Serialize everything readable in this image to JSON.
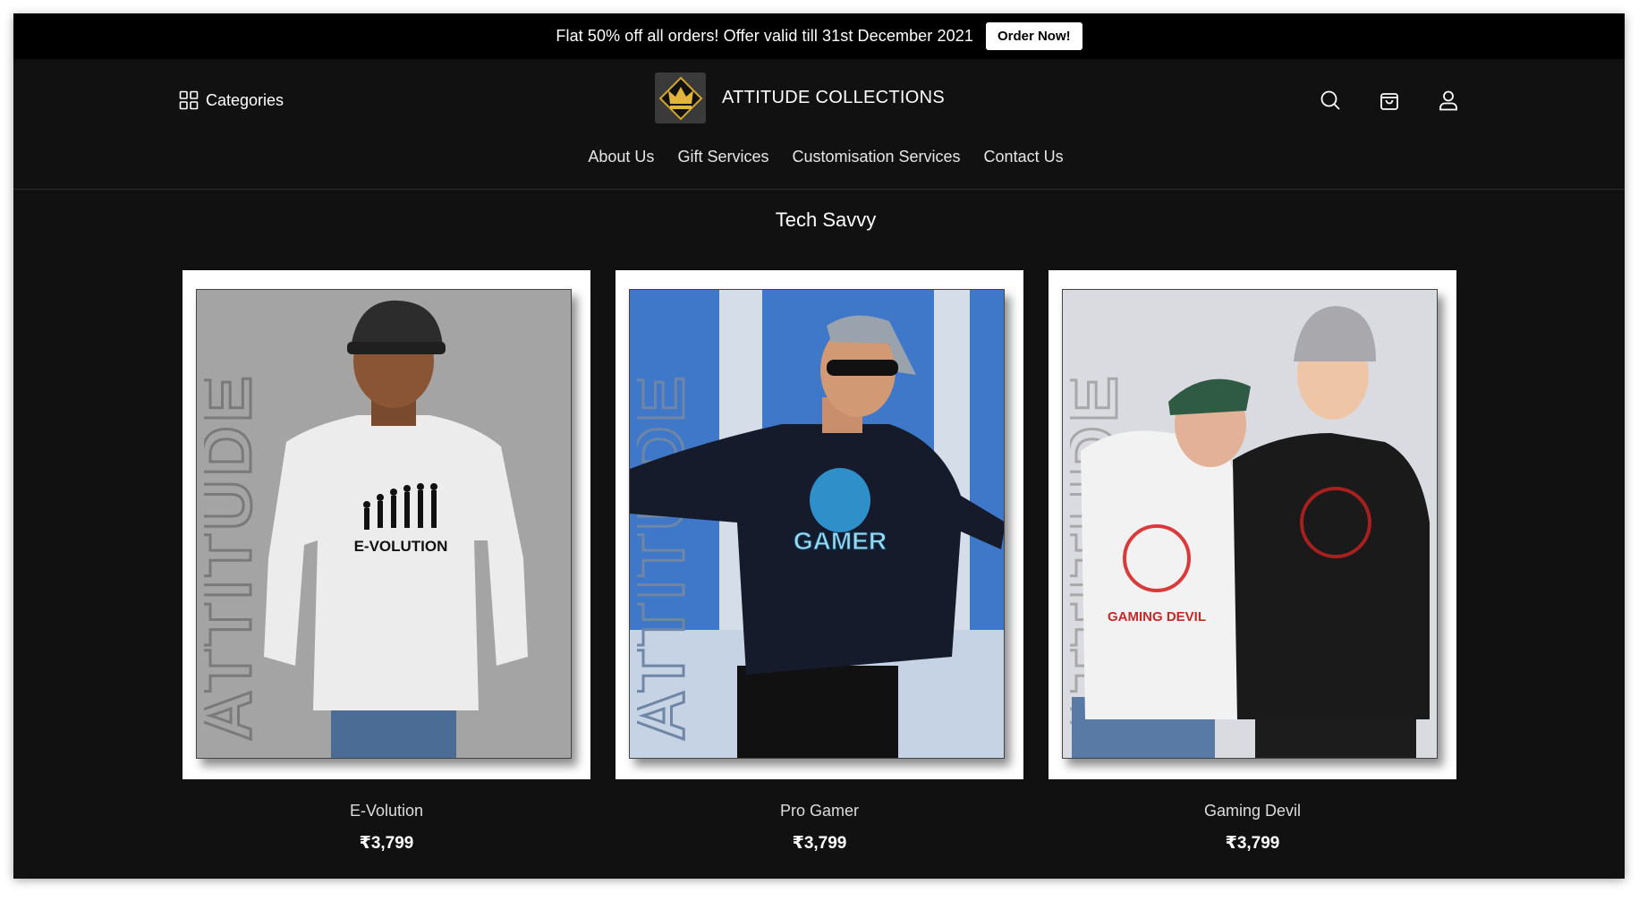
{
  "announcement": {
    "text": "Flat 50% off all orders! Offer valid till 31st December 2021",
    "button_label": "Order Now!"
  },
  "header": {
    "categories_label": "Categories",
    "brand_name": "ATTITUDE COLLECTIONS",
    "icons": [
      "search-icon",
      "cart-icon",
      "account-icon"
    ]
  },
  "nav": {
    "items": [
      "About Us",
      "Gift Services",
      "Customisation Services",
      "Contact Us"
    ]
  },
  "section": {
    "title": "Tech Savvy"
  },
  "products": [
    {
      "name": "E-Volution",
      "price": "₹3,799",
      "print": "E-VOLUTION"
    },
    {
      "name": "Pro Gamer",
      "price": "₹3,799",
      "print": "GAMER"
    },
    {
      "name": "Gaming Devil",
      "price": "₹3,799",
      "print": "GAMING DEVIL"
    }
  ],
  "watermark": "ATTITUDE",
  "colors": {
    "bar": "#000000",
    "background": "#111111",
    "accent": "#d4a62a"
  }
}
